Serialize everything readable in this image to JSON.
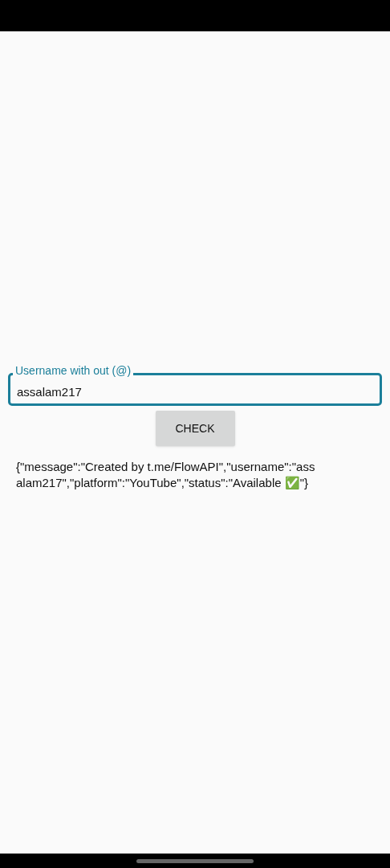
{
  "username_field": {
    "label": "Username with out (@)",
    "value": "assalam217"
  },
  "check_button": {
    "label": "CHECK"
  },
  "result": "{\"message\":\"Created by t.me/FlowAPI\",\"username\":\"assalam217\",\"platform\":\"YouTube\",\"status\":\"Available ✅\"}"
}
